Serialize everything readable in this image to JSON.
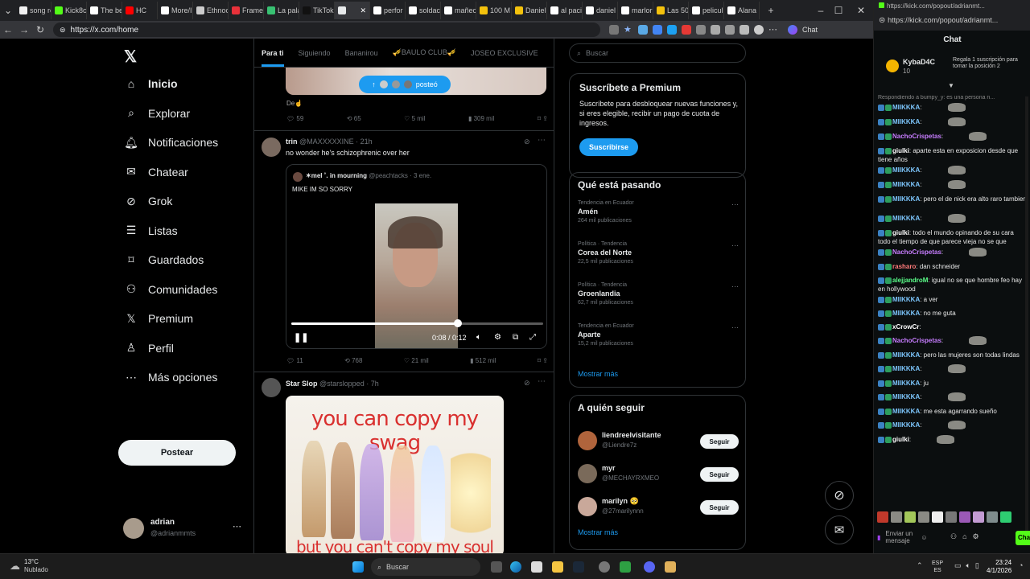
{
  "tabs": [
    {
      "title": "song re",
      "color": "#f1f1f1"
    },
    {
      "title": "Kick8c",
      "color": "#53fc18"
    },
    {
      "title": "The be",
      "color": "#ffffff"
    },
    {
      "title": "HC",
      "color": "#ff0000"
    },
    {
      "title": "More/I",
      "color": "#ffffff"
    },
    {
      "title": "Ethnoc",
      "color": "#cccccc"
    },
    {
      "title": "Frame",
      "color": "#e8313a"
    },
    {
      "title": "La pala",
      "color": "#38c172"
    },
    {
      "title": "TikTok",
      "color": "#111111"
    },
    {
      "title": "",
      "color": "#e7e9ea"
    },
    {
      "title": "perfor",
      "color": "#ffffff"
    },
    {
      "title": "soldac",
      "color": "#ffffff"
    },
    {
      "title": "mañec",
      "color": "#ffffff"
    },
    {
      "title": "100 M",
      "color": "#f4c20d"
    },
    {
      "title": "Daniel",
      "color": "#f4c20d"
    },
    {
      "title": "al paci",
      "color": "#ffffff"
    },
    {
      "title": "daniel",
      "color": "#ffffff"
    },
    {
      "title": "marlor",
      "color": "#ffffff"
    },
    {
      "title": "Las 50",
      "color": "#f4c20d"
    },
    {
      "title": "pelicul",
      "color": "#ffffff"
    },
    {
      "title": "Alana",
      "color": "#ffffff"
    }
  ],
  "browser": {
    "url": "https://x.com/home",
    "chat_button": "Chat"
  },
  "left_nav": {
    "items": [
      {
        "label": "Inicio",
        "icon": "home-icon"
      },
      {
        "label": "Explorar",
        "icon": "search-icon"
      },
      {
        "label": "Notificaciones",
        "icon": "bell-icon"
      },
      {
        "label": "Chatear",
        "icon": "mail-icon"
      },
      {
        "label": "Grok",
        "icon": "grok-icon"
      },
      {
        "label": "Listas",
        "icon": "list-icon"
      },
      {
        "label": "Guardados",
        "icon": "bookmark-icon"
      },
      {
        "label": "Comunidades",
        "icon": "people-icon"
      },
      {
        "label": "Premium",
        "icon": "x-logo-icon"
      },
      {
        "label": "Perfil",
        "icon": "person-icon"
      },
      {
        "label": "Más opciones",
        "icon": "more-circle-icon"
      }
    ],
    "post_button": "Postear",
    "account_name": "adrian",
    "account_handle": "@adrianmmts"
  },
  "feed": {
    "tabs": [
      "Para ti",
      "Siguiendo",
      "Bananirou",
      "🎺BAULO CLUB🎺",
      "JOSEO EXCLUSIVE"
    ],
    "posted_pill": "posteó",
    "tweet0": {
      "caption": "De☝",
      "replies": "59",
      "reposts": "65",
      "likes": "5 mil",
      "views": "309 mil"
    },
    "tweet1": {
      "name": "trin",
      "handle": "@MAXXXXXINE · 21h",
      "text": "no wonder he's schizophrenic over her",
      "quote_name": "✶mel ˚. in mourning",
      "quote_handle": "@peachtacks · 3 ene.",
      "quote_text": "MIKE IM SO SORRY",
      "video_time": "0:08 / 0:12",
      "video_progress": 0.66,
      "replies": "11",
      "reposts": "768",
      "likes": "21 mil",
      "views": "512 mil"
    },
    "tweet2": {
      "name": "Star Slop",
      "handle": "@starslopped · 7h",
      "meme_top": "you can copy my swag",
      "meme_bottom": "but you can't copy my soul"
    }
  },
  "right": {
    "search_placeholder": "Buscar",
    "premium": {
      "title": "Suscríbete a Premium",
      "text": "Suscríbete para desbloquear nuevas funciones y, si eres elegible, recibir un pago de cuota de ingresos.",
      "button": "Suscribirse"
    },
    "trends": {
      "title": "Qué está pasando",
      "items": [
        {
          "context": "Tendencia en Ecuador",
          "name": "Amén",
          "count": "264 mil publicaciones"
        },
        {
          "context": "Política · Tendencia",
          "name": "Corea del Norte",
          "count": "22,5 mil publicaciones"
        },
        {
          "context": "Política · Tendencia",
          "name": "Groenlandia",
          "count": "62,7 mil publicaciones"
        },
        {
          "context": "Tendencia en Ecuador",
          "name": "Aparte",
          "count": "15,2 mil publicaciones"
        }
      ],
      "more": "Mostrar más"
    },
    "who": {
      "title": "A quién seguir",
      "items": [
        {
          "name": "liendreelvisitante",
          "handle": "@Liendre7z",
          "button": "Seguir"
        },
        {
          "name": "myr",
          "handle": "@MECHAYRXMEO",
          "button": "Seguir"
        },
        {
          "name": "marilyn 🥺",
          "handle": "@27marilynnn",
          "button": "Seguir"
        }
      ],
      "more": "Mostrar más"
    }
  },
  "kick": {
    "url": "https://kick.com/popout/adrianmt...",
    "title": "Chat",
    "top_user": "KybaD4C",
    "top_count": "10",
    "top_promo": "Regala 1 suscripción para tomar la posición 2",
    "reply_banner": "Respondiendo a bumpy_y: es una persona n...",
    "messages": [
      {
        "user": "MIIKKKA",
        "color": "#7ec8ff",
        "text": "",
        "emote": true
      },
      {
        "user": "MIIKKKA",
        "color": "#7ec8ff",
        "text": "",
        "emote": true
      },
      {
        "user": "NachoCrispetas",
        "color": "#c77dff",
        "text": "",
        "emote": true
      },
      {
        "user": "giulki",
        "color": "#ffffff",
        "text": "aparte esta en exposicion desde que tiene          años",
        "emote": false
      },
      {
        "user": "MIIKKKA",
        "color": "#7ec8ff",
        "text": "",
        "emote": true
      },
      {
        "user": "MIIKKKA",
        "color": "#7ec8ff",
        "text": "",
        "emote": true
      },
      {
        "user": "MIIKKKA",
        "color": "#7ec8ff",
        "text": "pero el de nick era alto raro tambien",
        "emote": false
      },
      {
        "user": "MIIKKKA",
        "color": "#7ec8ff",
        "text": "",
        "emote": true
      },
      {
        "user": "giulki",
        "color": "#ffffff",
        "text": "todo el mundo opinando de su cara todo el tiempo de que parece vieja no se que",
        "emote": false
      },
      {
        "user": "NachoCrispetas",
        "color": "#c77dff",
        "text": "",
        "emote": true
      },
      {
        "user": "rasharo",
        "color": "#ff7b7b",
        "text": "dan schneider",
        "emote": false
      },
      {
        "user": "alejjandroM",
        "color": "#5bff8a",
        "text": "igual no se que hombre feo hay en hollywood",
        "emote": false
      },
      {
        "user": "MIIKKKA",
        "color": "#7ec8ff",
        "text": "a ver",
        "emote": false
      },
      {
        "user": "MIIKKKA",
        "color": "#7ec8ff",
        "text": "no me guta",
        "emote": false
      },
      {
        "user": "xCrowCr",
        "color": "#ffffff",
        "text": "",
        "emote": false
      },
      {
        "user": "NachoCrispetas",
        "color": "#c77dff",
        "text": "",
        "emote": true
      },
      {
        "user": "MIIKKKA",
        "color": "#7ec8ff",
        "text": "pero las mujeres son todas lindas",
        "emote": false
      },
      {
        "user": "MIIKKKA",
        "color": "#7ec8ff",
        "text": "",
        "emote": true
      },
      {
        "user": "MIIKKKA",
        "color": "#7ec8ff",
        "text": "ju",
        "emote": false
      },
      {
        "user": "MIIKKKA",
        "color": "#7ec8ff",
        "text": "",
        "emote": true
      },
      {
        "user": "MIIKKKA",
        "color": "#7ec8ff",
        "text": "me esta agarrando sueño",
        "emote": false
      },
      {
        "user": "MIIKKKA",
        "color": "#7ec8ff",
        "text": "",
        "emote": true
      },
      {
        "user": "giulki",
        "color": "#ffffff",
        "text": "",
        "emote": true
      }
    ],
    "input_placeholder": "Enviar un mensaje",
    "send_label": "Chat"
  },
  "taskbar": {
    "temp": "13°C",
    "weather": "Nublado",
    "search": "Buscar",
    "lang1": "ESP",
    "lang2": "ES",
    "time": "23:24",
    "date": "4/1/2026"
  }
}
